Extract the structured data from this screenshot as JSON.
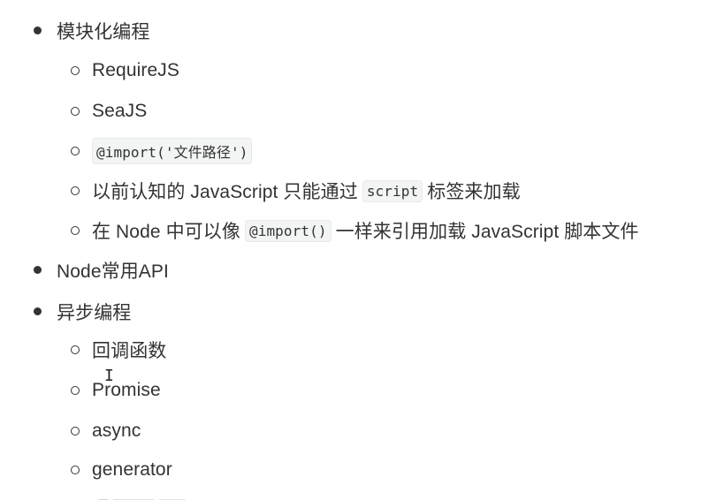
{
  "outline": {
    "item1": {
      "label": "模块化编程",
      "children": {
        "c1": "RequireJS",
        "c2": "SeaJS",
        "c3_code": "@import('文件路径')",
        "c4": {
          "before": "以前认知的 JavaScript 只能通过",
          "code": "script",
          "after": "标签来加载"
        },
        "c5": {
          "before": "在 Node 中可以像",
          "code": "@import()",
          "after": "一样来引用加载 JavaScript 脚本文件"
        }
      }
    },
    "item2": {
      "label": "Node常用API"
    },
    "item3": {
      "label": "异步编程",
      "children": {
        "c1": "回调函数",
        "c2": "Promise",
        "c3": "async",
        "c4": "generator"
      }
    }
  },
  "cursor_glyph": "I"
}
